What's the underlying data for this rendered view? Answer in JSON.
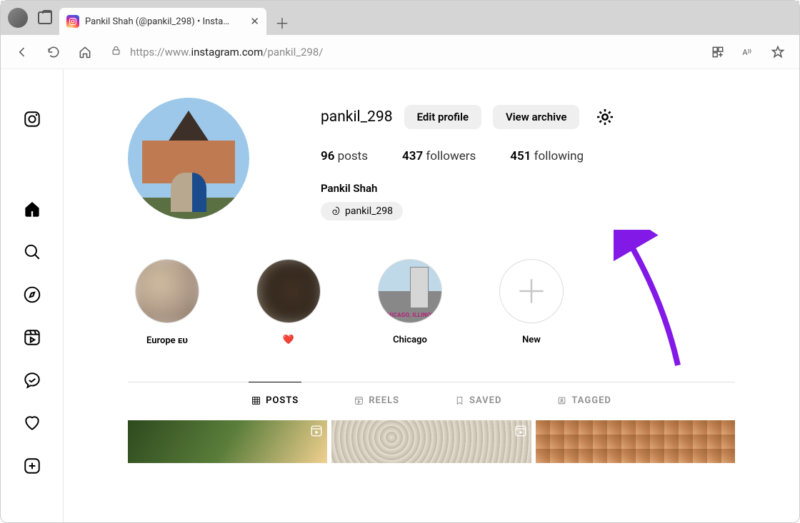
{
  "browser": {
    "tab_title": "Pankil Shah (@pankil_298) • Insta…",
    "url_display_prefix": "https://www.",
    "url_display_host": "instagram.com",
    "url_display_path": "/pankil_298/"
  },
  "profile": {
    "username": "pankil_298",
    "edit_btn": "Edit profile",
    "archive_btn": "View archive",
    "posts_count": "96",
    "posts_label": " posts",
    "followers_count": "437",
    "followers_label": " followers",
    "following_count": "451",
    "following_label": " following",
    "display_name": "Pankil Shah",
    "threads_handle": "pankil_298"
  },
  "highlights": [
    {
      "label": "Europe ᴇᴜ"
    },
    {
      "label": "❤️"
    },
    {
      "label": "Chicago"
    },
    {
      "label": "New"
    }
  ],
  "tabs": {
    "posts": "POSTS",
    "reels": "REELS",
    "saved": "SAVED",
    "tagged": "TAGGED"
  }
}
